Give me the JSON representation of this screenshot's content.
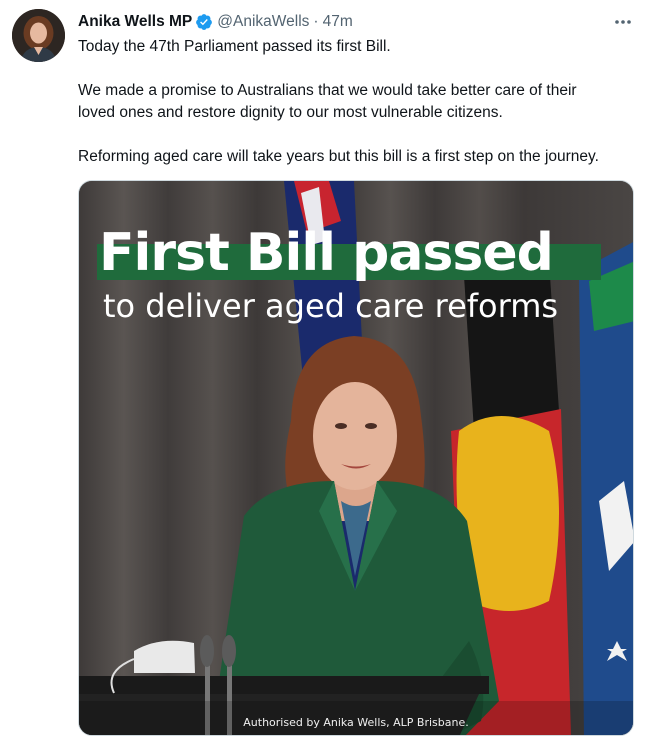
{
  "tweet": {
    "author_name": "Anika Wells MP",
    "handle": "@AnikaWells",
    "separator": "·",
    "time": "47m",
    "paragraphs": [
      "Today the 47th Parliament passed its first Bill.",
      "We made a promise to Australians that we would take better care of their",
      "loved ones and restore dignity to our most vulnerable citizens.",
      "Reforming aged care will take years but this bill is a first step on the journey."
    ]
  },
  "media": {
    "title": "First Bill passed",
    "subtitle": "to deliver aged care reforms",
    "authorised": "Authorised by Anika Wells, ALP Brisbane.",
    "colors": {
      "title_bar": "#1f6b3c",
      "jacket": "#1f5a3a",
      "curtain": "#4b4745"
    }
  },
  "icons": {
    "verified": "verified-badge-icon",
    "more": "more-options-icon"
  }
}
